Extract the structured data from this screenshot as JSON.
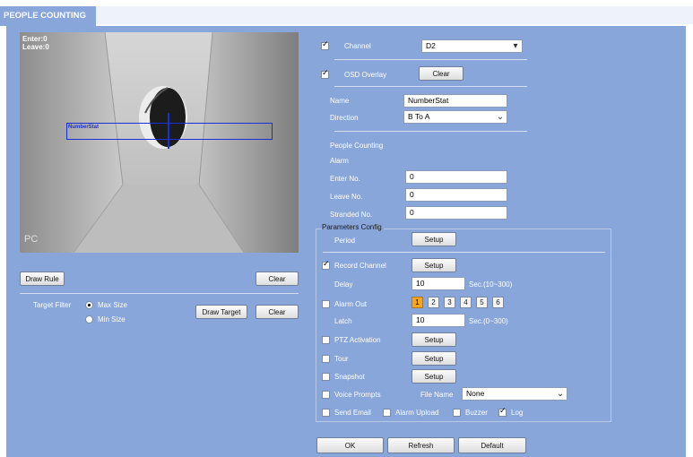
{
  "header": {
    "title": "PEOPLE COUNTING"
  },
  "video": {
    "enter_text": "Enter:0",
    "leave_text": "Leave:0",
    "rule_name": "NumberStat",
    "brand_text": "PC"
  },
  "left": {
    "draw_rule_label": "Draw Rule",
    "clear_label": "Clear",
    "target_filter_label": "Target Filter",
    "max_size_label": "Max Size",
    "min_size_label": "Min Size",
    "draw_target_label": "Draw Target",
    "clear_target_label": "Clear",
    "selected_size": "Max Size"
  },
  "right": {
    "channel_label": "Channel",
    "channel_value": "D2",
    "osd_label": "OSD Overlay",
    "osd_clear_label": "Clear",
    "name_label": "Name",
    "name_value": "NumberStat",
    "direction_label": "Direction",
    "direction_value": "B To A",
    "people_counting_label": "People Counting",
    "alarm_label": "Alarm",
    "enter_no_label": "Enter No.",
    "enter_no_value": "0",
    "leave_no_label": "Leave No.",
    "leave_no_value": "0",
    "stranded_no_label": "Stranded No.",
    "stranded_no_value": "0"
  },
  "params": {
    "title": "Parameters Config",
    "period_label": "Period",
    "setup_label": "Setup",
    "record_channel_label": "Record Channel",
    "delay_label": "Delay",
    "delay_value": "10",
    "delay_range": "Sec.(10~300)",
    "alarm_out_label": "Alarm Out",
    "alarm_out_channels": [
      "1",
      "2",
      "3",
      "4",
      "5",
      "6"
    ],
    "alarm_out_active": "1",
    "latch_label": "Latch",
    "latch_value": "10",
    "latch_range": "Sec.(0~300)",
    "ptz_label": "PTZ Activation",
    "tour_label": "Tour",
    "snapshot_label": "Snapshot",
    "voice_label": "Voice Prompts",
    "file_name_label": "File Name",
    "file_name_value": "None",
    "send_email_label": "Send Email",
    "alarm_upload_label": "Alarm Upload",
    "buzzer_label": "Buzzer",
    "log_label": "Log"
  },
  "footer": {
    "ok_label": "OK",
    "refresh_label": "Refresh",
    "default_label": "Default"
  },
  "colors": {
    "panel": "#88a6d9",
    "header": "#eef3fb",
    "accent": "#f5a623",
    "rule_line": "#1a2fd6"
  }
}
